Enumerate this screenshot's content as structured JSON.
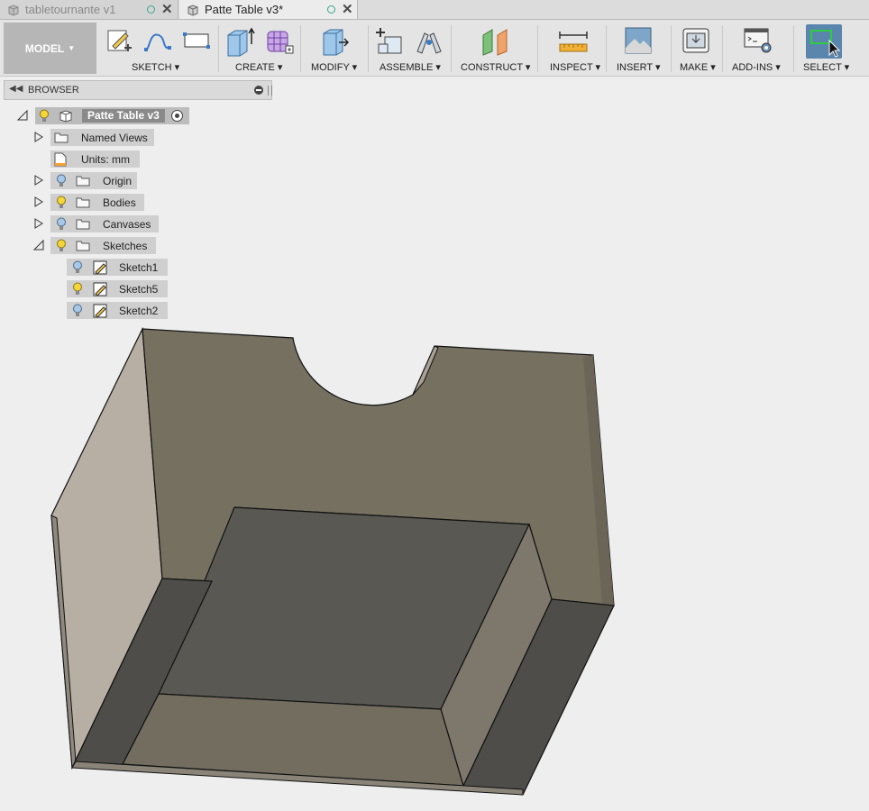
{
  "tabs": [
    {
      "label": "tabletournante v1",
      "active": false
    },
    {
      "label": "Patte Table v3*",
      "active": true
    }
  ],
  "toolbar": {
    "workspace": "MODEL",
    "groups": [
      {
        "label": "SKETCH"
      },
      {
        "label": "CREATE"
      },
      {
        "label": "MODIFY"
      },
      {
        "label": "ASSEMBLE"
      },
      {
        "label": "CONSTRUCT"
      },
      {
        "label": "INSPECT"
      },
      {
        "label": "INSERT"
      },
      {
        "label": "MAKE"
      },
      {
        "label": "ADD-INS"
      },
      {
        "label": "SELECT"
      }
    ]
  },
  "browser": {
    "title": "BROWSER",
    "root": "Patte Table v3",
    "nodes": [
      {
        "label": "Named Views"
      },
      {
        "label": "Units: mm"
      },
      {
        "label": "Origin"
      },
      {
        "label": "Bodies"
      },
      {
        "label": "Canvases"
      },
      {
        "label": "Sketches"
      }
    ],
    "sketches": [
      {
        "label": "Sketch1"
      },
      {
        "label": "Sketch5"
      },
      {
        "label": "Sketch2"
      }
    ]
  },
  "colors": {
    "toolbar_bg": "#e4e4e4",
    "select_active": "#5a86ad",
    "bulb_on": "#f4d63a",
    "bulb_off": "#a8c8e8",
    "viewport_bg": "#eeeeee"
  }
}
